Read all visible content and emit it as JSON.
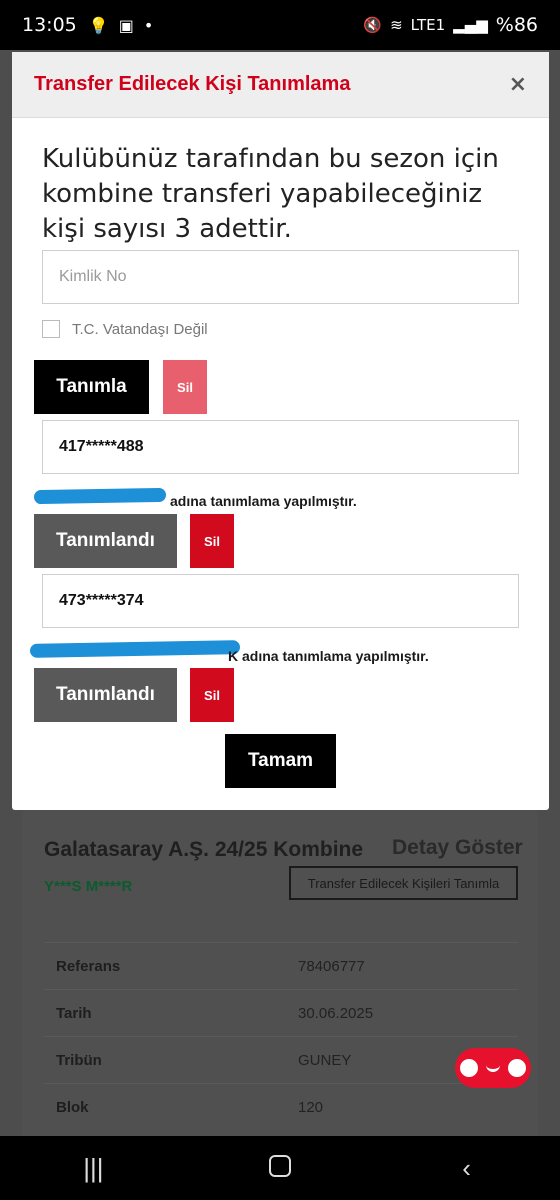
{
  "status_bar": {
    "time": "13:05",
    "battery": "%86",
    "network": "LTE1"
  },
  "modal": {
    "title": "Transfer Edilecek Kişi Tanımlama",
    "close_label": "×",
    "info_text": "Kulübünüz tarafından bu sezon için kombine transferi yapabileceğiniz kişi sayısı 3 adettir.",
    "id_input_placeholder": "Kimlik No",
    "checkbox_label": "T.C. Vatandaşı Değil",
    "define_button": "Tanımla",
    "delete_button": "Sil",
    "entries": [
      {
        "id_value": "417*****488",
        "note": "adına tanımlama yapılmıştır.",
        "status_button": "Tanımlandı",
        "delete_button": "Sil"
      },
      {
        "id_value": "473*****374",
        "note": "K adına tanımlama yapılmıştır.",
        "status_button": "Tanımlandı",
        "delete_button": "Sil"
      }
    ],
    "ok_button": "Tamam"
  },
  "background": {
    "title": "Galatasaray A.Ş. 24/25 Kombine",
    "detail_link": "Detay Göster",
    "owner": "Y***S M****R",
    "transfer_button": "Transfer Edilecek Kişileri Tanımla",
    "rows": [
      {
        "label": "Referans",
        "value": "78406777"
      },
      {
        "label": "Tarih",
        "value": "30.06.2025"
      },
      {
        "label": "Tribün",
        "value": "GUNEY"
      },
      {
        "label": "Blok",
        "value": "120"
      }
    ]
  },
  "colors": {
    "accent": "#d0021b",
    "dark_button": "#000000",
    "status_button": "#595959",
    "delete_light": "#e8606e",
    "delete": "#d10a1e",
    "redaction": "#1e90d8"
  }
}
